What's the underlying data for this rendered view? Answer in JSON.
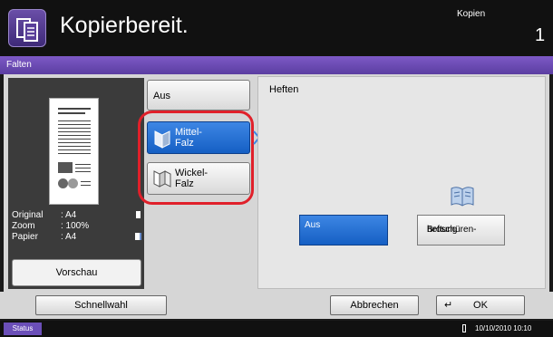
{
  "header": {
    "title": "Kopierbereit.",
    "mode": "Kopien",
    "count": "1"
  },
  "function": {
    "title": "Falten"
  },
  "preview": {
    "info": [
      {
        "key": "Original",
        "value": ": A4"
      },
      {
        "key": "Zoom",
        "value": ": 100%"
      },
      {
        "key": "Papier",
        "value": ": A4"
      }
    ],
    "button": "Vorschau"
  },
  "options": {
    "aus": "Aus",
    "mittel_line1": "Mittel-",
    "mittel_line2": "Falz",
    "wickel_line1": "Wickel-",
    "wickel_line2": "Falz",
    "selected": "Mittel-Falz"
  },
  "heften": {
    "title": "Heften",
    "aus": "Aus",
    "bro_line1": "Broschüren-",
    "bro_line2": "heftung",
    "selected": "Aus"
  },
  "bottom": {
    "schnellwahl": "Schnellwahl",
    "abbrechen": "Abbrechen",
    "ok": "OK"
  },
  "status": {
    "label": "Status",
    "datetime": "10/10/2010  10:10"
  },
  "colors": {
    "accent": "#6b4fb8",
    "selected": "#1d67cc",
    "highlight": "#e0202a"
  }
}
